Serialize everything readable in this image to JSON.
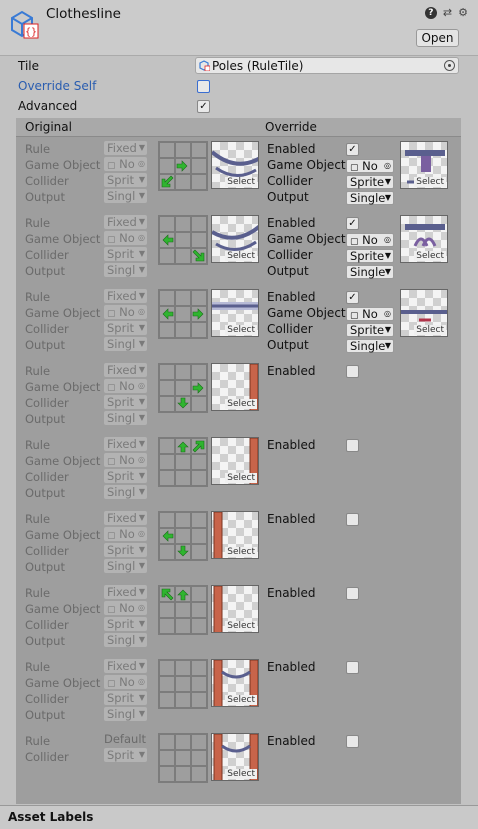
{
  "header": {
    "title": "Clothesline",
    "open_label": "Open",
    "icon": "rule-tile-asset-icon"
  },
  "props": {
    "tile_label": "Tile",
    "tile_value": "Poles (RuleTile)",
    "override_self_label": "Override Self",
    "override_self_checked": false,
    "advanced_label": "Advanced",
    "advanced_checked": true
  },
  "table": {
    "original_header": "Original",
    "override_header": "Override"
  },
  "labels": {
    "rule": "Rule",
    "game_object": "Game Object",
    "collider": "Collider",
    "output": "Output",
    "enabled": "Enabled",
    "select": "Select"
  },
  "rules": [
    {
      "rule": "Fixed",
      "go": "No",
      "collider": "Sprit",
      "output": "Singl",
      "arrows": [
        "right@1,1",
        "downleft@0,2"
      ],
      "enabled": true,
      "o_go": "No",
      "o_collider": "Sprite",
      "o_output": "Single",
      "sprite": "rope-corner-tl"
    },
    {
      "rule": "Fixed",
      "go": "No",
      "collider": "Sprit",
      "output": "Singl",
      "arrows": [
        "left@0,1",
        "downright@2,2"
      ],
      "enabled": true,
      "o_go": "No",
      "o_collider": "Sprite",
      "o_output": "Single",
      "sprite": "rope-corner-tr"
    },
    {
      "rule": "Fixed",
      "go": "No",
      "collider": "Sprit",
      "output": "Singl",
      "arrows": [
        "left@0,1",
        "right@2,1"
      ],
      "enabled": true,
      "o_go": "No",
      "o_collider": "Sprite",
      "o_output": "Single",
      "sprite": "rope-middle"
    },
    {
      "rule": "Fixed",
      "go": "No",
      "collider": "Sprit",
      "output": "Singl",
      "arrows": [
        "right@2,1",
        "down@1,2"
      ],
      "enabled": false,
      "sprite": "pole-right"
    },
    {
      "rule": "Fixed",
      "go": "No",
      "collider": "Sprit",
      "output": "Singl",
      "arrows": [
        "up@1,0",
        "upright@2,0"
      ],
      "enabled": false,
      "sprite": "pole-right"
    },
    {
      "rule": "Fixed",
      "go": "No",
      "collider": "Sprit",
      "output": "Singl",
      "arrows": [
        "left@0,1",
        "down@1,2"
      ],
      "enabled": false,
      "sprite": "pole-left"
    },
    {
      "rule": "Fixed",
      "go": "No",
      "collider": "Sprit",
      "output": "Singl",
      "arrows": [
        "upleft@0,0",
        "up@1,0"
      ],
      "enabled": false,
      "sprite": "pole-left"
    },
    {
      "rule": "Fixed",
      "go": "No",
      "collider": "Sprit",
      "output": "Singl",
      "arrows": [],
      "enabled": false,
      "sprite": "poles-both"
    },
    {
      "rule": "Default",
      "collider": "Sprit",
      "arrows": [],
      "enabled": false,
      "sprite": "poles-both",
      "default": true
    }
  ],
  "footer": {
    "asset_labels": "Asset Labels"
  },
  "colors": {
    "arrow": "#2fb52f",
    "pole": "#c8644a",
    "rope": "#5a5f8e"
  }
}
